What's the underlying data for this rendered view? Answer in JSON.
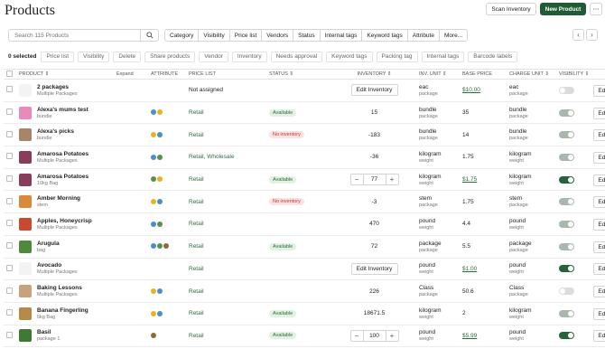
{
  "header": {
    "title": "Products",
    "scan_label": "Scan Inventory",
    "new_label": "New Product",
    "more_label": "⋯"
  },
  "search": {
    "placeholder": "Search 115 Products"
  },
  "filters": [
    "Category",
    "Visibility",
    "Price list",
    "Vendors",
    "Status",
    "Internal tags",
    "Keyword tags",
    "Attribute",
    "More..."
  ],
  "bulk": {
    "selected": "0 selected",
    "actions": [
      "Price list",
      "Visibility",
      "Delete",
      "Share products",
      "Vendor",
      "Inventory",
      "Needs approval",
      "Keyword tags",
      "Packing tag",
      "Internal tags",
      "Barcode labels"
    ]
  },
  "columns": {
    "product": "PRODUCT",
    "expand": "Expand",
    "attribute": "ATTRIBUTE",
    "price_list": "PRICE LIST",
    "status": "STATUS",
    "inventory": "INVENTORY",
    "inv_unit": "INV. UNIT",
    "base_price": "BASE PRICE",
    "charge_unit": "CHARGE UNIT",
    "visibility": "VISIBILITY"
  },
  "colors": {
    "accent": "#1f5b35",
    "available_bg": "#e3f1e4",
    "no_inventory_bg": "#fbe2e2"
  },
  "rows": [
    {
      "name": "2 packages",
      "sub": "Multiple Packages",
      "thumb": "#f3f3f3",
      "attrs": [],
      "price_list": "Not assigned",
      "status": "",
      "inv_type": "button",
      "inventory": "Edit Inventory",
      "inv_unit": "eac",
      "inv_unit_sub": "package",
      "base_price": "$10.00",
      "price_link": true,
      "charge_unit": "eac",
      "charge_sub": "package",
      "visibility": "off",
      "edit": "Edit"
    },
    {
      "name": "Alexa's mums test",
      "sub": "bundle",
      "thumb": "#e88bb8",
      "attrs": [
        "ib",
        "iy"
      ],
      "price_list": "Retail",
      "status": "Available",
      "inv_type": "text",
      "inventory": "15",
      "inv_unit": "bundle",
      "inv_unit_sub": "package",
      "base_price": "35",
      "price_link": false,
      "charge_unit": "bundle",
      "charge_sub": "package",
      "visibility": "part",
      "edit": "Edit"
    },
    {
      "name": "Alexa's picks",
      "sub": "bundle",
      "thumb": "#a8846a",
      "attrs": [
        "iy",
        "ib"
      ],
      "price_list": "Retail",
      "status": "No inventory",
      "inv_type": "text",
      "inventory": "-183",
      "inv_unit": "bundle",
      "inv_unit_sub": "package",
      "base_price": "14",
      "price_link": false,
      "charge_unit": "bundle",
      "charge_sub": "package",
      "visibility": "part",
      "edit": "Edit"
    },
    {
      "name": "Amarosa Potatoes",
      "sub": "Multiple Packages",
      "thumb": "#8a3d5a",
      "attrs": [
        "ib",
        "ig"
      ],
      "price_list": "Retail,  Wholesale",
      "status": "",
      "inv_type": "text",
      "inventory": "-36",
      "inv_unit": "kilogram",
      "inv_unit_sub": "weight",
      "base_price": "1.75",
      "price_link": false,
      "charge_unit": "kilogram",
      "charge_sub": "weight",
      "visibility": "part",
      "edit": "Edit"
    },
    {
      "name": "Amarosa Potatoes",
      "sub": "10kg Bag",
      "thumb": "#8a3d5a",
      "attrs": [
        "ig",
        "iy"
      ],
      "price_list": "Retail",
      "status": "Available",
      "inv_type": "stepper",
      "inventory": "77",
      "inv_unit": "kilogram",
      "inv_unit_sub": "weight",
      "base_price": "$1.75",
      "price_link": true,
      "charge_unit": "kilogram",
      "charge_sub": "weight",
      "visibility": "on",
      "edit": "Edit"
    },
    {
      "name": "Amber Morning",
      "sub": "stem",
      "thumb": "#d88a3a",
      "attrs": [
        "iy",
        "ib"
      ],
      "price_list": "Retail",
      "status": "No inventory",
      "inv_type": "text",
      "inventory": "-3",
      "inv_unit": "stem",
      "inv_unit_sub": "package",
      "base_price": "1.75",
      "price_link": false,
      "charge_unit": "stem",
      "charge_sub": "package",
      "visibility": "part",
      "edit": "Edit"
    },
    {
      "name": "Apples, Honeycrisp",
      "sub": "Multiple Packages",
      "thumb": "#c94a2e",
      "attrs": [
        "ib",
        "ig"
      ],
      "price_list": "Retail",
      "status": "",
      "inv_type": "text",
      "inventory": "470",
      "inv_unit": "pound",
      "inv_unit_sub": "weight",
      "base_price": "4.4",
      "price_link": false,
      "charge_unit": "pound",
      "charge_sub": "weight",
      "visibility": "part",
      "edit": "Edit"
    },
    {
      "name": "Arugula",
      "sub": "bag",
      "thumb": "#4f8a3a",
      "attrs": [
        "ib",
        "ig",
        "ibr"
      ],
      "price_list": "Retail",
      "status": "Available",
      "inv_type": "text",
      "inventory": "72",
      "inv_unit": "package",
      "inv_unit_sub": "package",
      "base_price": "5.5",
      "price_link": false,
      "charge_unit": "package",
      "charge_sub": "package",
      "visibility": "part",
      "edit": "Edit"
    },
    {
      "name": "Avocado",
      "sub": "Multiple Packages",
      "thumb": "#f3f3f3",
      "attrs": [],
      "price_list": "Retail",
      "status": "",
      "inv_type": "button",
      "inventory": "Edit Inventory",
      "inv_unit": "pound",
      "inv_unit_sub": "weight",
      "base_price": "$1.00",
      "price_link": true,
      "charge_unit": "pound",
      "charge_sub": "weight",
      "visibility": "on",
      "edit": "Edit"
    },
    {
      "name": "Baking Lessons",
      "sub": "Multiple Packages",
      "thumb": "#c9a27a",
      "attrs": [
        "iy",
        "ib"
      ],
      "price_list": "Retail",
      "status": "",
      "inv_type": "text",
      "inventory": "226",
      "inv_unit": "Class",
      "inv_unit_sub": "package",
      "base_price": "50.6",
      "price_link": false,
      "charge_unit": "Class",
      "charge_sub": "package",
      "visibility": "off",
      "edit": "Edit"
    },
    {
      "name": "Banana Fingerling",
      "sub": "5kg Bag",
      "thumb": "#b58a4a",
      "attrs": [
        "iy",
        "ib"
      ],
      "price_list": "Retail",
      "status": "Available",
      "inv_type": "text",
      "inventory": "18671.5",
      "inv_unit": "kilogram",
      "inv_unit_sub": "weight",
      "base_price": "2",
      "price_link": false,
      "charge_unit": "kilogram",
      "charge_sub": "weight",
      "visibility": "part",
      "edit": "Edit"
    },
    {
      "name": "Basil",
      "sub": "package 1",
      "thumb": "#3f7a34",
      "attrs": [
        "ibr"
      ],
      "price_list": "Retail",
      "status": "Available",
      "inv_type": "stepper",
      "inventory": "100",
      "inv_unit": "pound",
      "inv_unit_sub": "weight",
      "base_price": "$5.99",
      "price_link": true,
      "charge_unit": "pound",
      "charge_sub": "weight",
      "visibility": "on",
      "edit": "Edit"
    }
  ]
}
